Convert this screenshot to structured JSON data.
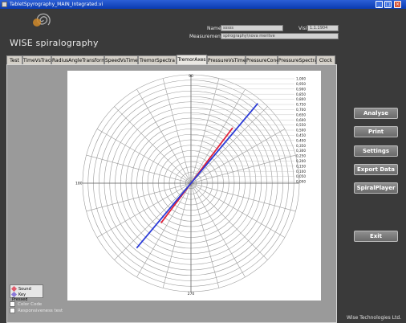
{
  "window": {
    "title": "TabletSpyrography_MAIN_Integrated.vi",
    "min": "_",
    "max": "□",
    "close": "×"
  },
  "header": {
    "logo_text": "WISE spiralography",
    "name_label": "Name",
    "name_value": "sssss",
    "visit_label": "Visit",
    "visit_value": "1.1.1904",
    "measurement_label": "Measurement",
    "measurement_value": "spirography\\nova meritve"
  },
  "tabs": [
    {
      "label": "Test"
    },
    {
      "label": "TimeVsTrace"
    },
    {
      "label": "RadiusAngleTransform"
    },
    {
      "label": "SpeedVsTime"
    },
    {
      "label": "TremorSpectra"
    },
    {
      "label": "TremorAxes",
      "active": true
    },
    {
      "label": "PressureVsTime"
    },
    {
      "label": "PressureCone"
    },
    {
      "label": "PressureSpectra"
    },
    {
      "label": "Clock"
    }
  ],
  "legend": {
    "sound": "Sound",
    "key_pressed": "Key Pressed",
    "sound_color": "#e05a6a",
    "key_color": "#8a78d8"
  },
  "checks": {
    "color_code": "Color Code",
    "responsiveness": "Responsiveness test"
  },
  "buttons": {
    "analyse": "Analyse",
    "print": "Print",
    "settings": "Settings",
    "export": "Export Data",
    "player": "SpiralPlayer",
    "exit": "Exit"
  },
  "footer": "Wise Technologies Ltd.",
  "chart_data": {
    "type": "polar",
    "angle_labels": [
      "90",
      "180",
      "270"
    ],
    "rings": 20,
    "radial_spokes_deg": 15,
    "radial_labels": [
      "1,000",
      "0,950",
      "0,900",
      "0,850",
      "0,800",
      "0,750",
      "0,700",
      "0,650",
      "0,600",
      "0,550",
      "0,500",
      "0,450",
      "0,400",
      "0,350",
      "0,300",
      "0,250",
      "0,200",
      "0,150",
      "0,100",
      "0,050",
      "0,000"
    ],
    "rmax": 1.0,
    "series": [
      {
        "color": "#e0223a",
        "angle_deg": 53,
        "r_from": 0.46,
        "r_to": 0.64
      },
      {
        "color": "#2b3bd8",
        "angle_deg": 50,
        "r_from": 0.78,
        "r_to": 0.96
      }
    ]
  }
}
